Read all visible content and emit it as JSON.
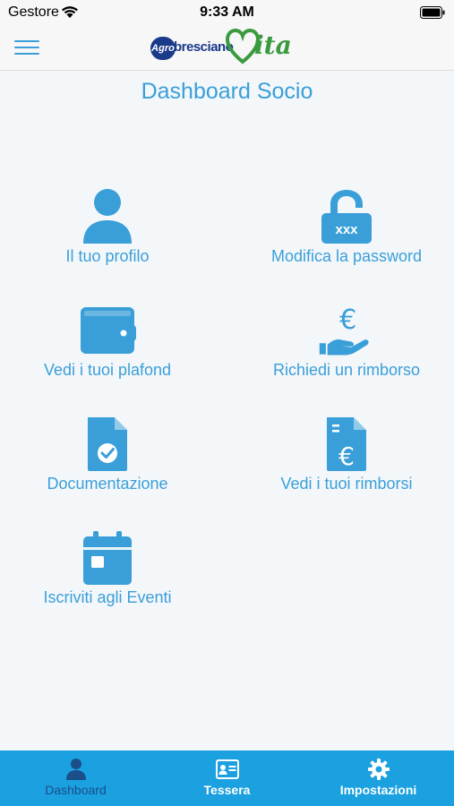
{
  "status_bar": {
    "carrier": "Gestore",
    "time": "9:33 AM"
  },
  "header": {
    "logo_agro": "Agro",
    "logo_bresciano": "bresciano",
    "logo_vita": "ita"
  },
  "page": {
    "title": "Dashboard Socio"
  },
  "tiles": [
    {
      "label": "Il tuo profilo",
      "icon": "user-icon"
    },
    {
      "label": "Modifica la password",
      "icon": "lock-icon"
    },
    {
      "label": "Vedi i tuoi plafond",
      "icon": "wallet-icon"
    },
    {
      "label": "Richiedi un rimborso",
      "icon": "euro-hand-icon"
    },
    {
      "label": "Documentazione",
      "icon": "document-check-icon"
    },
    {
      "label": "Vedi i tuoi rimborsi",
      "icon": "euro-document-icon"
    },
    {
      "label": "Iscriviti agli Eventi",
      "icon": "calendar-icon"
    }
  ],
  "tab_bar": {
    "tabs": [
      {
        "label": "Dashboard",
        "icon": "user-icon",
        "active": true
      },
      {
        "label": "Tessera",
        "icon": "id-card-icon",
        "active": false
      },
      {
        "label": "Impostazioni",
        "icon": "gear-icon",
        "active": false
      }
    ]
  },
  "colors": {
    "accent": "#3a9fd8",
    "tab_bar": "#1ba0e0",
    "active_tab": "#1a4f8a",
    "brand_green": "#3a9a3e",
    "brand_blue": "#1a3a8a"
  }
}
